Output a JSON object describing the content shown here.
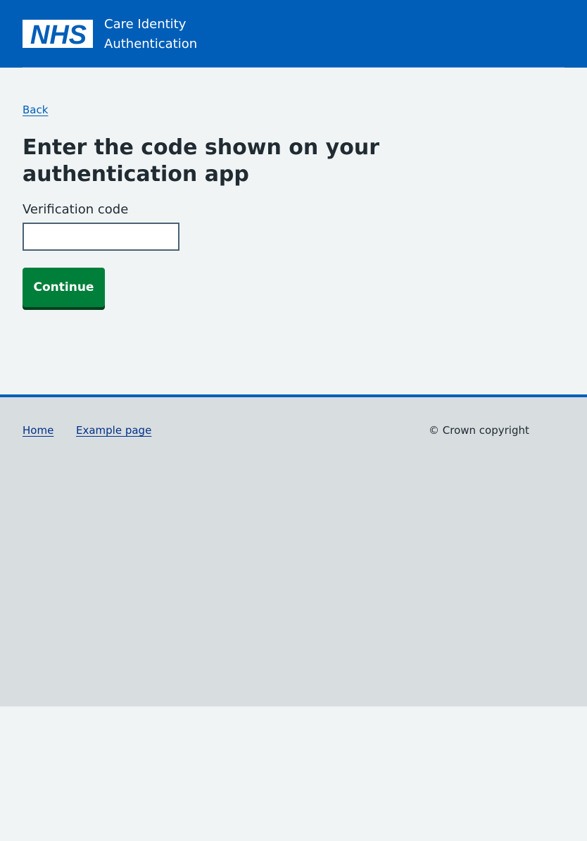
{
  "header": {
    "logo_text": "NHS",
    "service_name_line1": "Care Identity",
    "service_name_line2": "Authentication"
  },
  "nav": {
    "back_label": "Back"
  },
  "main": {
    "title": "Enter the code shown on your authentication app",
    "field_label": "Verification code",
    "field_value": "",
    "continue_label": "Continue"
  },
  "footer": {
    "links": [
      {
        "label": "Home"
      },
      {
        "label": "Example page"
      }
    ],
    "copyright": "© Crown copyright"
  },
  "colors": {
    "brand_blue": "#005eb8",
    "button_green": "#007f3b",
    "page_background": "#f0f4f5",
    "footer_background": "#d8dde0",
    "link": "#005eb8",
    "footer_link": "#003087",
    "text": "#212b32"
  },
  "icons": {
    "logo": "nhs-logo-icon"
  }
}
